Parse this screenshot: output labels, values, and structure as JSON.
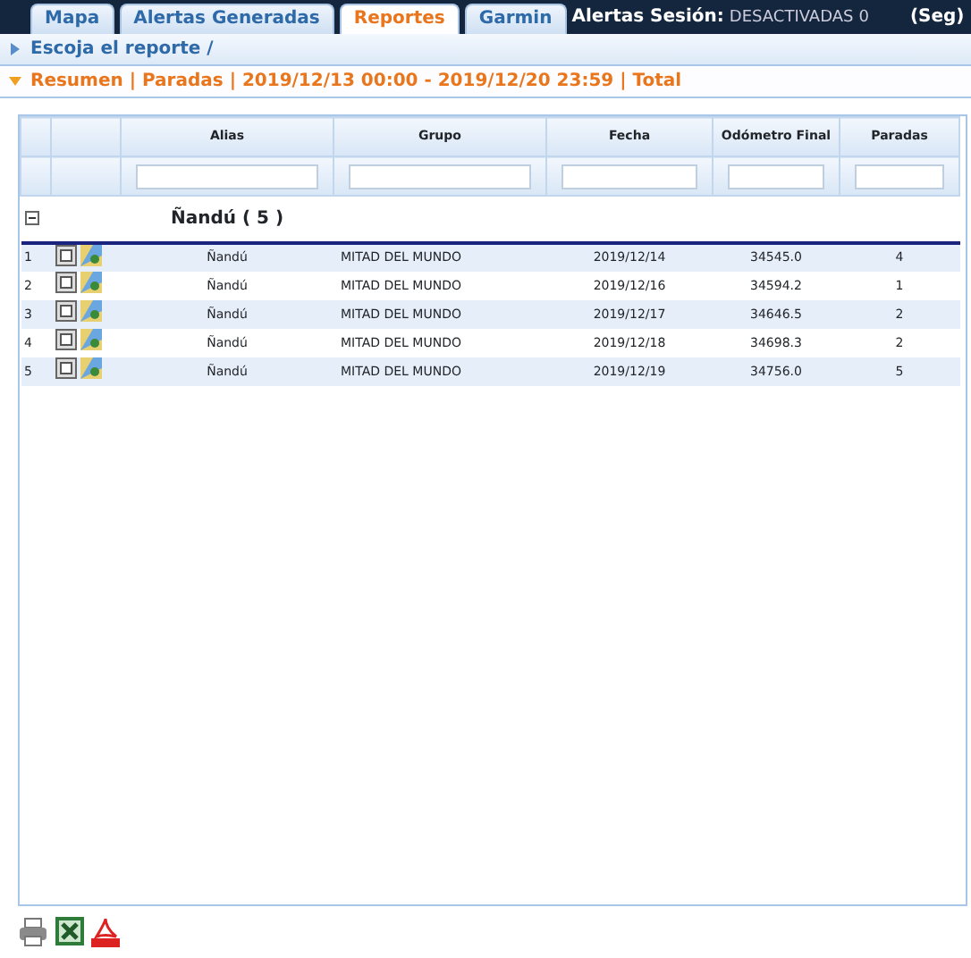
{
  "tabs": [
    {
      "label": "Mapa",
      "selected": false
    },
    {
      "label": "Alertas Generadas",
      "selected": false
    },
    {
      "label": "Reportes",
      "selected": true
    },
    {
      "label": "Garmin",
      "selected": false
    }
  ],
  "session": {
    "label": "Alertas Sesión:",
    "status": "DESACTIVADAS",
    "count": "0",
    "unit": "(Seg)"
  },
  "panels": [
    {
      "title": "Escoja el reporte /",
      "expanded": false
    },
    {
      "title": "Resumen | Paradas | 2019/12/13 00:00 - 2019/12/20 23:59 | Total",
      "expanded": true
    }
  ],
  "table": {
    "columns": [
      "Alias",
      "Grupo",
      "Fecha",
      "Odómetro Final",
      "Paradas"
    ],
    "group": {
      "title": "Ñandú ( 5 )",
      "expanded": true
    },
    "rows": [
      {
        "number": "1",
        "cells": [
          "Ñandú",
          "MITAD DEL MUNDO",
          "2019/12/14",
          "34545.0",
          "4"
        ]
      },
      {
        "number": "2",
        "cells": [
          "Ñandú",
          "MITAD DEL MUNDO",
          "2019/12/16",
          "34594.2",
          "1"
        ]
      },
      {
        "number": "3",
        "cells": [
          "Ñandú",
          "MITAD DEL MUNDO",
          "2019/12/17",
          "34646.5",
          "2"
        ]
      },
      {
        "number": "4",
        "cells": [
          "Ñandú",
          "MITAD DEL MUNDO",
          "2019/12/18",
          "34698.3",
          "2"
        ]
      },
      {
        "number": "5",
        "cells": [
          "Ñandú",
          "MITAD DEL MUNDO",
          "2019/12/19",
          "34756.0",
          "5"
        ]
      }
    ]
  }
}
